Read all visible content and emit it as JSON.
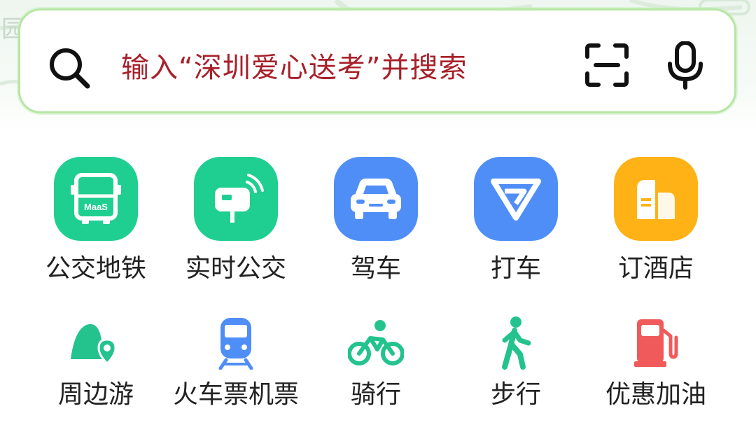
{
  "search": {
    "placeholder": "输入“深圳爱心送考”并搜索",
    "icons": [
      "search-icon",
      "scan-icon",
      "microphone-icon"
    ]
  },
  "map_background": {
    "label": "园"
  },
  "primary_services": [
    {
      "label": "公交地铁",
      "icon": "bus-icon",
      "badge": "MaaS",
      "color": "#1fcf91"
    },
    {
      "label": "实时公交",
      "icon": "bus-stop-signal-icon",
      "color": "#1fcf91"
    },
    {
      "label": "驾车",
      "icon": "car-icon",
      "color": "#4f8ef7"
    },
    {
      "label": "打车",
      "icon": "taxi-logo-icon",
      "color": "#4f8ef7"
    },
    {
      "label": "订酒店",
      "icon": "hotel-building-icon",
      "color": "#ffb216"
    }
  ],
  "secondary_services": [
    {
      "label": "周边游",
      "icon": "mountain-pin-icon",
      "color": "#24c38e"
    },
    {
      "label": "火车票机票",
      "icon": "train-icon",
      "color": "#4f8ef7"
    },
    {
      "label": "骑行",
      "icon": "cycling-icon",
      "color": "#24c38e"
    },
    {
      "label": "步行",
      "icon": "walking-icon",
      "color": "#24c38e"
    },
    {
      "label": "优惠加油",
      "icon": "fuel-pump-icon",
      "color": "#f05a5a"
    }
  ]
}
